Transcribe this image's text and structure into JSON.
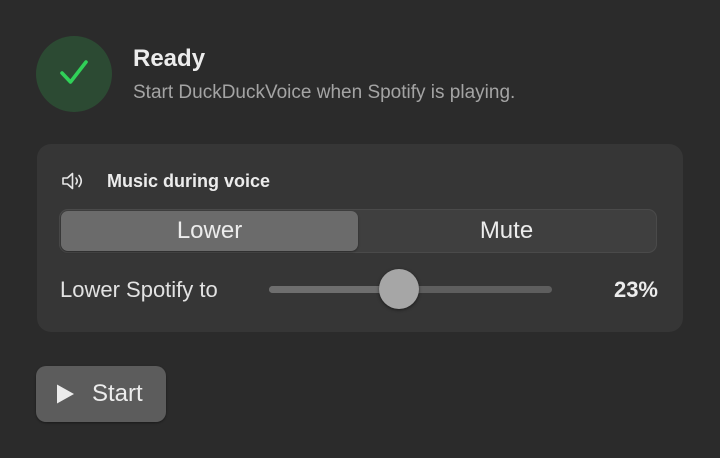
{
  "status": {
    "title": "Ready",
    "subtitle": "Start DuckDuckVoice when Spotify is playing.",
    "icon": "checkmark-icon",
    "accent_color": "#30d158"
  },
  "music_section": {
    "icon": "speaker-icon",
    "title": "Music during voice",
    "options": [
      {
        "label": "Lower",
        "selected": true
      },
      {
        "label": "Mute",
        "selected": false
      }
    ],
    "slider": {
      "label": "Lower Spotify to",
      "value_text": "23%",
      "level_fraction": 0.46
    }
  },
  "start_button": {
    "icon": "play-icon",
    "label": "Start"
  }
}
